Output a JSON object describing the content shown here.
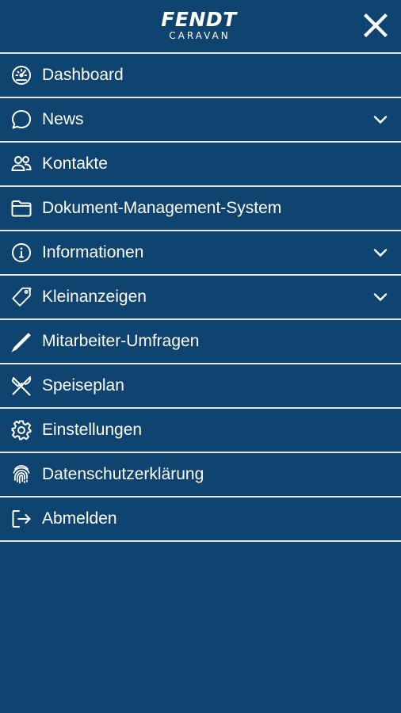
{
  "header": {
    "logo_main": "FENDT",
    "logo_sub": "CARAVAN",
    "close_icon": "close-icon"
  },
  "menu": {
    "items": [
      {
        "label": "Dashboard",
        "icon": "speedometer-icon",
        "expandable": false
      },
      {
        "label": "News",
        "icon": "chat-bubble-icon",
        "expandable": true
      },
      {
        "label": "Kontakte",
        "icon": "users-icon",
        "expandable": false
      },
      {
        "label": "Dokument-Management-System",
        "icon": "folder-icon",
        "expandable": false
      },
      {
        "label": "Informationen",
        "icon": "info-icon",
        "expandable": true
      },
      {
        "label": "Kleinanzeigen",
        "icon": "tag-icon",
        "expandable": true
      },
      {
        "label": "Mitarbeiter-Umfragen",
        "icon": "pencil-icon",
        "expandable": false
      },
      {
        "label": "Speiseplan",
        "icon": "utensils-icon",
        "expandable": false
      },
      {
        "label": "Einstellungen",
        "icon": "gear-icon",
        "expandable": false
      },
      {
        "label": "Datenschutzerklärung",
        "icon": "fingerprint-icon",
        "expandable": false
      },
      {
        "label": "Abmelden",
        "icon": "logout-icon",
        "expandable": false
      }
    ]
  },
  "colors": {
    "background": "#0f4470",
    "divider": "#e3e6ea",
    "text": "#ffffff"
  }
}
